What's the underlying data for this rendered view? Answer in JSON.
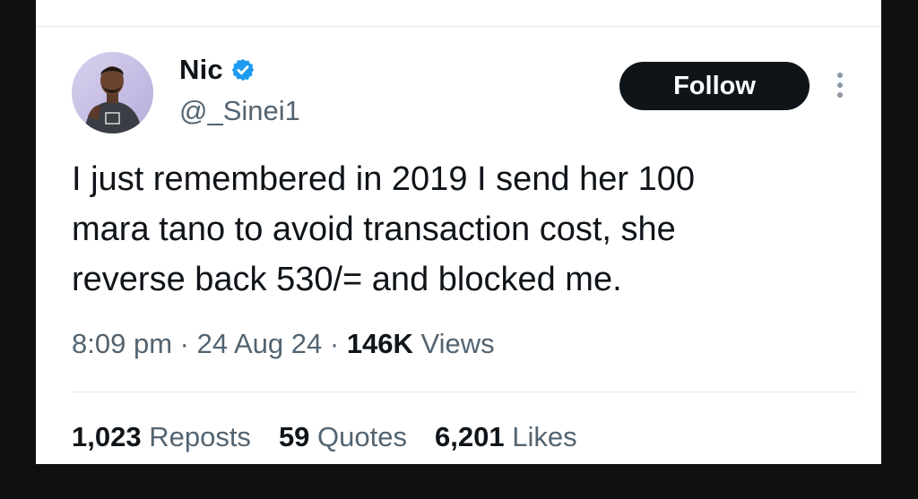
{
  "tweet": {
    "author": {
      "display_name": "Nic",
      "handle": "@_Sinei1",
      "verified_icon": "verified-badge-icon",
      "avatar": "profile-photo"
    },
    "follow_label": "Follow",
    "more_icon": "more-options-icon",
    "text": "I just remembered in 2019 I send her 100\nmara tano to avoid transaction cost, she\nreverse back 530/= and blocked me.",
    "meta": {
      "time": "8:09 pm",
      "separator": "·",
      "date": "24 Aug 24",
      "views_count": "146K",
      "views_label": "Views"
    },
    "stats": {
      "reposts_count": "1,023",
      "reposts_label": "Reposts",
      "quotes_count": "59",
      "quotes_label": "Quotes",
      "likes_count": "6,201",
      "likes_label": "Likes"
    }
  },
  "colors": {
    "page_background": "#0f1111",
    "card_background": "#ffffff",
    "text_primary": "#0f1419",
    "text_secondary": "#536471",
    "verified_blue": "#1d9bf0",
    "divider": "#e6e9eb"
  }
}
